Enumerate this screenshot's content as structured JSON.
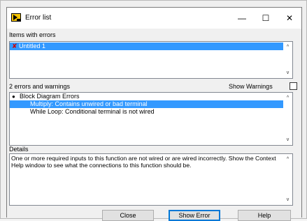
{
  "window": {
    "title": "Error list",
    "minimize_glyph": "—",
    "maximize_glyph": "☐",
    "close_glyph": "✕",
    "icon": "error-list-app-icon"
  },
  "items_section": {
    "label": "Items with errors",
    "items": [
      {
        "icon": "red-x-icon",
        "glyph": "✘",
        "label": "Untitled 1",
        "selected": true
      }
    ]
  },
  "errors_section": {
    "count_label": "2 errors and warnings",
    "show_warnings_label": "Show Warnings",
    "show_warnings_checked": false,
    "group_bullet": "●",
    "group_label": "Block Diagram Errors",
    "errors": [
      {
        "label": "Multiply: Contains unwired or bad terminal",
        "selected": true
      },
      {
        "label": "While Loop: Conditional terminal is not wired",
        "selected": false
      }
    ]
  },
  "details_section": {
    "label": "Details",
    "text": "One or more required inputs to this function are not wired or are wired incorrectly. Show the Context Help window to see what the connections to this function should be."
  },
  "buttons": {
    "close": "Close",
    "show_error": "Show Error",
    "help": "Help"
  },
  "scroll": {
    "up": "^",
    "down": "v"
  },
  "colors": {
    "selection": "#3399ff",
    "error_x": "#d00000",
    "default_button_border": "#0078d7"
  }
}
